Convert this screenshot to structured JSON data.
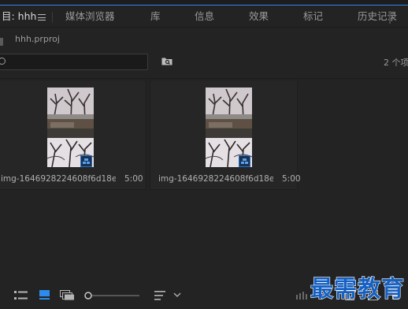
{
  "tabs": [
    {
      "label": "目: hhh",
      "active": true
    },
    {
      "label": "媒体浏览器",
      "active": false
    },
    {
      "label": "库",
      "active": false
    },
    {
      "label": "信息",
      "active": false
    },
    {
      "label": "效果",
      "active": false
    },
    {
      "label": "标记",
      "active": false
    },
    {
      "label": "历史记录",
      "active": false
    }
  ],
  "project": {
    "file_name": "hhh.prproj"
  },
  "search": {
    "value": "",
    "placeholder": ""
  },
  "item_count": "2 个项",
  "clips": [
    {
      "name": "img-1646928224608f6d18ea...",
      "duration": "5:00"
    },
    {
      "name": "img-1646928224608f6d18ea...",
      "duration": "5:00"
    }
  ],
  "icons": {
    "menu": "hamburger-menu-icon",
    "search": "search-icon",
    "bin": "find-bin-icon",
    "list_view": "list-view-icon",
    "icon_view": "icon-view-icon",
    "freeform_view": "freeform-view-icon",
    "zoom_slider": "zoom-slider",
    "sort": "sort-icon",
    "chevron": "chevron-down-icon"
  },
  "colors": {
    "accent": "#2d8ceb",
    "badge": "#2e6fc4",
    "watermark": "#1560c2"
  },
  "watermark": "最需教育"
}
